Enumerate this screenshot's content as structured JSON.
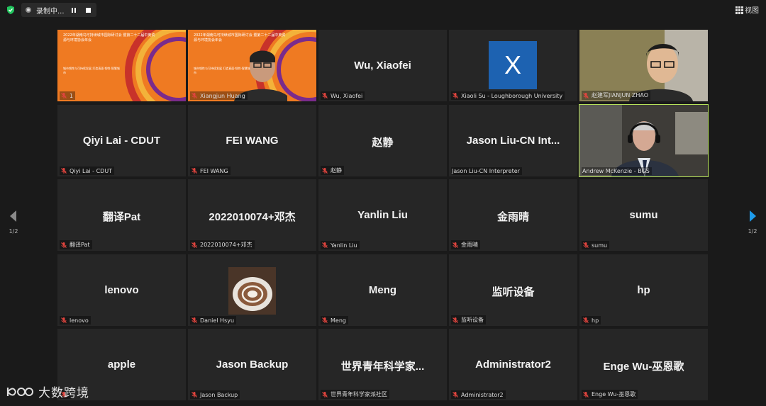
{
  "topbar": {
    "record_label": "录制中...",
    "view_label": "视图"
  },
  "colors": {
    "active_border": "#b7e35a",
    "tile_bg": "#262626",
    "mic_muted": "#e0443e",
    "accent_blue": "#1e9bea"
  },
  "tiles": [
    {
      "label": "1",
      "type": "slide"
    },
    {
      "label": "Xiangjun Huang",
      "type": "slide-person"
    },
    {
      "name": "Wu, Xiaofei",
      "label": "Wu, Xiaofei",
      "type": "name"
    },
    {
      "avatar": "X",
      "label": "Xiaoli Su - Loughborough University",
      "type": "avatar"
    },
    {
      "label": "赵建军JIANJUN ZHAO",
      "type": "video"
    },
    {
      "name": "Qiyi Lai - CDUT",
      "label": "Qiyi Lai - CDUT",
      "type": "name"
    },
    {
      "name": "FEI WANG",
      "label": "FEI WANG",
      "type": "name"
    },
    {
      "name": "赵静",
      "label": "赵静",
      "type": "name"
    },
    {
      "name": "Jason Liu-CN Int...",
      "label": "Jason Liu-CN Interpreter",
      "type": "name",
      "unmuted": true
    },
    {
      "label": "Andrew McKenzie - BGS",
      "type": "video-active",
      "unmuted": true
    },
    {
      "name": "翻译Pat",
      "label": "翻译Pat",
      "type": "name"
    },
    {
      "name": "2022010074+邓杰",
      "label": "2022010074+邓杰",
      "type": "name"
    },
    {
      "name": "Yanlin Liu",
      "label": "Yanlin Liu",
      "type": "name"
    },
    {
      "name": "金雨晴",
      "label": "金雨晴",
      "type": "name"
    },
    {
      "name": "sumu",
      "label": "sumu",
      "type": "name"
    },
    {
      "name": "lenovo",
      "label": "lenovo",
      "type": "name"
    },
    {
      "label": "Daniel Hsyu",
      "type": "photo"
    },
    {
      "name": "Meng",
      "label": "Meng",
      "type": "name"
    },
    {
      "name": "监听设备",
      "label": "监听设备",
      "type": "name"
    },
    {
      "name": "hp",
      "label": "hp",
      "type": "name"
    },
    {
      "name": "apple",
      "label": "",
      "type": "name"
    },
    {
      "name": "Jason Backup",
      "label": "Jason Backup",
      "type": "name"
    },
    {
      "name": "世界青年科学家...",
      "label": "世界青年科学家派社区",
      "type": "name"
    },
    {
      "name": "Administrator2",
      "label": "Administrator2",
      "type": "name"
    },
    {
      "name": "Enge Wu-巫恩歌",
      "label": "Enge Wu-巫恩歌",
      "type": "name"
    }
  ],
  "pager": {
    "left": "1/2",
    "right": "1/2"
  },
  "watermark": {
    "text": "大数跨境"
  },
  "slide_text": {
    "title": "2022年湖南乌可持续城市国际研讨会 暨第二十二届中英资源与环境协会年会",
    "subtitle": "2022 INTERNATIONAL SYMPOSIUM ON RESILIENT AND SUSTAINABLE CITY & THE 22ND ANNUAL GENERAL MEETING OF UK-CHINA",
    "body": "城市韧性与可持续发展 打造直面·韧性·智慧城市"
  }
}
